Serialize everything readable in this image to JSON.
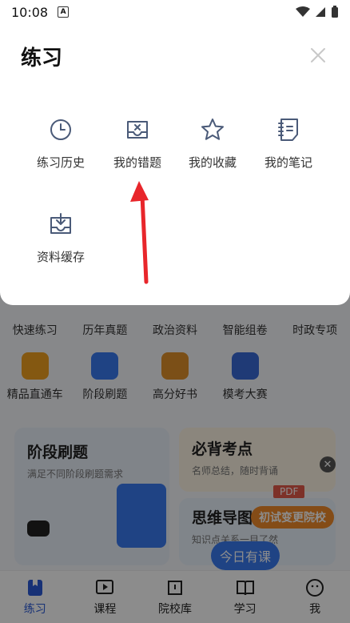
{
  "status_bar": {
    "time": "10:08",
    "badge": "A"
  },
  "sheet": {
    "title": "练习",
    "options": [
      {
        "label": "练习历史",
        "icon": "clock-icon"
      },
      {
        "label": "我的错题",
        "icon": "error-tray-icon"
      },
      {
        "label": "我的收藏",
        "icon": "star-icon"
      },
      {
        "label": "我的笔记",
        "icon": "notebook-icon"
      },
      {
        "label": "资料缓存",
        "icon": "download-tray-icon"
      }
    ]
  },
  "background": {
    "grid_row1": [
      "快速练习",
      "历年真题",
      "政治资料",
      "智能组卷",
      "时政专项"
    ],
    "grid_row2": [
      "精品直通车",
      "阶段刷题",
      "高分好书",
      "模考大赛"
    ],
    "cards": {
      "stage": {
        "title": "阶段刷题",
        "subtitle": "满足不同阶段刷题需求"
      },
      "must": {
        "title": "必背考点",
        "subtitle": "名师总结，随时背诵"
      },
      "mindmap": {
        "title": "思维导图",
        "subtitle": "知识点关系一目了然"
      },
      "pdf_label": "PDF",
      "school_badge": "初试变更院校"
    },
    "today_bubble": "今日有课",
    "tabs": [
      {
        "label": "练习",
        "icon": "bookmark-book-icon",
        "active": true
      },
      {
        "label": "课程",
        "icon": "play-icon",
        "active": false
      },
      {
        "label": "院校库",
        "icon": "school-icon",
        "active": false
      },
      {
        "label": "学习",
        "icon": "open-book-icon",
        "active": false
      },
      {
        "label": "我",
        "icon": "smile-icon",
        "active": false
      }
    ]
  },
  "colors": {
    "accent": "#2a5ad8",
    "icon_stroke": "#4a5a78",
    "arrow": "#e8262b"
  }
}
